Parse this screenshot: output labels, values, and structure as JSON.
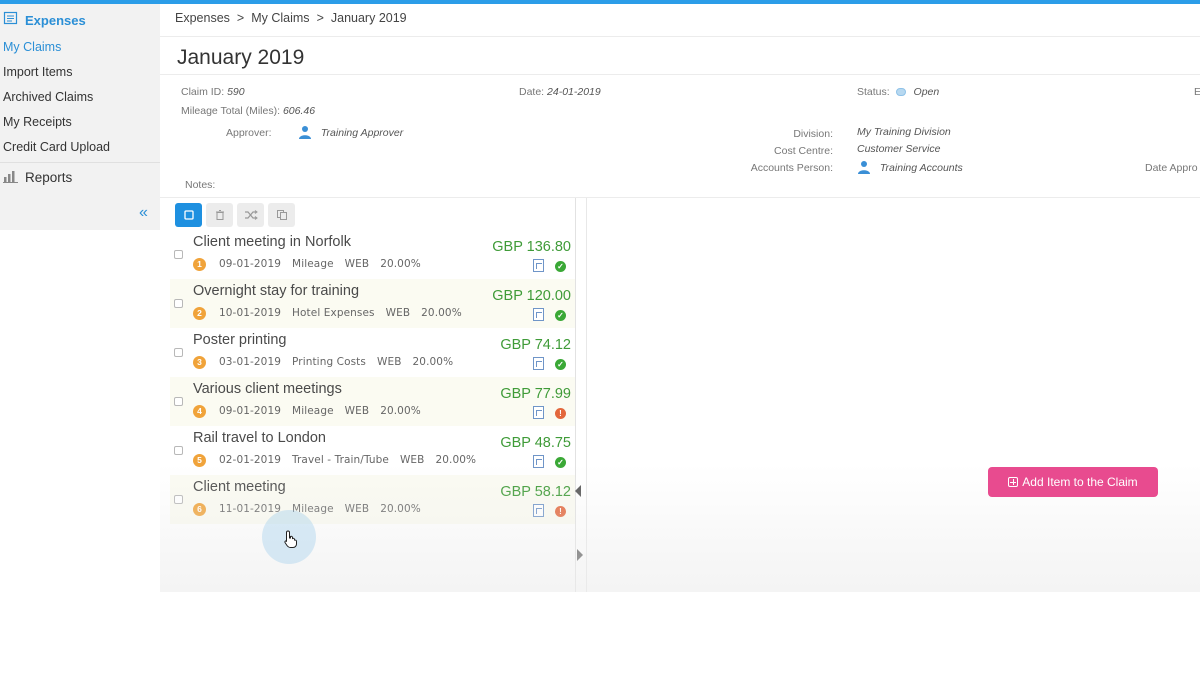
{
  "sidebar": {
    "header": "Expenses",
    "items": [
      {
        "label": "My Claims",
        "active": true
      },
      {
        "label": "Import Items"
      },
      {
        "label": "Archived Claims"
      },
      {
        "label": "My Receipts"
      },
      {
        "label": "Credit Card Upload"
      }
    ],
    "reports": "Reports"
  },
  "breadcrumb": [
    "Expenses",
    ">",
    "My Claims",
    ">",
    "January 2019"
  ],
  "page_title": "January 2019",
  "claim": {
    "claim_id_label": "Claim ID:",
    "claim_id": "590",
    "mileage_label": "Mileage Total (Miles):",
    "mileage": "606.46",
    "date_label": "Date:",
    "date": "24-01-2019",
    "status_label": "Status:",
    "status": "Open",
    "approver_label": "Approver:",
    "approver": "Training Approver",
    "division_label": "Division:",
    "division": "My Training Division",
    "cost_centre_label": "Cost Centre:",
    "cost_centre": "Customer Service",
    "accounts_label": "Accounts Person:",
    "accounts": "Training Accounts",
    "date_approved_label": "Date Appro",
    "edge_label": "E",
    "notes_label": "Notes:"
  },
  "items": [
    {
      "num": "1",
      "title": "Client meeting in Norfolk",
      "date": "09-01-2019",
      "category": "Mileage",
      "source": "WEB",
      "vat": "20.00%",
      "amount": "GBP 136.80",
      "status": "ok"
    },
    {
      "num": "2",
      "title": "Overnight stay for training",
      "date": "10-01-2019",
      "category": "Hotel Expenses",
      "source": "WEB",
      "vat": "20.00%",
      "amount": "GBP 120.00",
      "status": "ok"
    },
    {
      "num": "3",
      "title": "Poster printing",
      "date": "03-01-2019",
      "category": "Printing Costs",
      "source": "WEB",
      "vat": "20.00%",
      "amount": "GBP 74.12",
      "status": "ok"
    },
    {
      "num": "4",
      "title": "Various client meetings",
      "date": "09-01-2019",
      "category": "Mileage",
      "source": "WEB",
      "vat": "20.00%",
      "amount": "GBP 77.99",
      "status": "warn"
    },
    {
      "num": "5",
      "title": "Rail travel to London",
      "date": "02-01-2019",
      "category": "Travel - Train/Tube",
      "source": "WEB",
      "vat": "20.00%",
      "amount": "GBP 48.75",
      "status": "ok"
    },
    {
      "num": "6",
      "title": "Client meeting",
      "date": "11-01-2019",
      "category": "Mileage",
      "source": "WEB",
      "vat": "20.00%",
      "amount": "GBP 58.12",
      "status": "warn"
    }
  ],
  "add_button": "Add Item to the Claim",
  "colors": {
    "accent": "#2b9de8",
    "amount": "#3f9b38",
    "add_button": "#e84b8f",
    "badge": "#f0a33a"
  }
}
